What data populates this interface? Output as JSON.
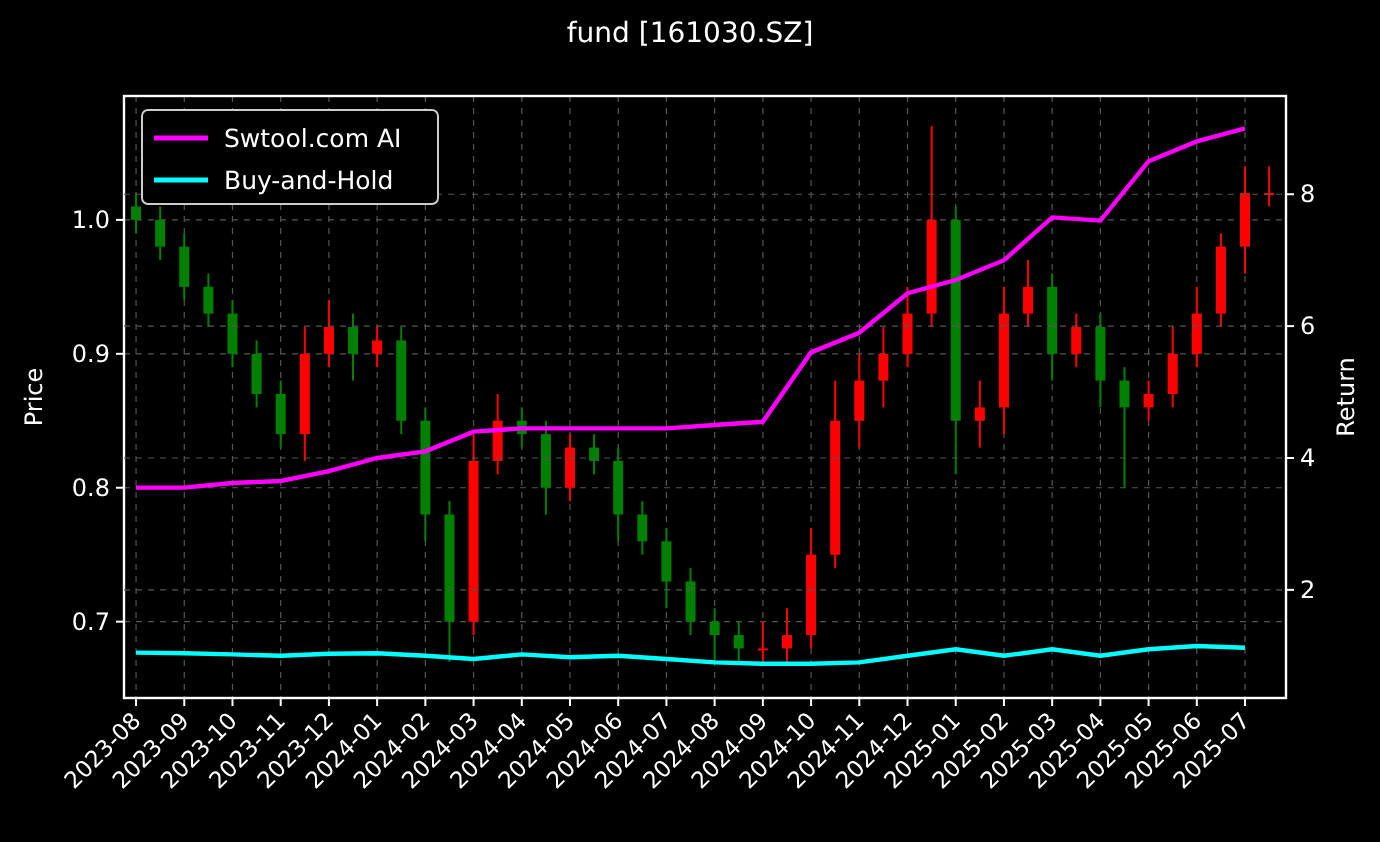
{
  "price_chart": {
    "chart_data": {
      "type": "candlestick",
      "title": "fund [161030.SZ]",
      "ylabel": "Price",
      "ylim": [
        0.643,
        1.0925
      ],
      "grid": true,
      "categories": [
        "2023-08",
        null,
        "2023-09",
        null,
        "2023-10",
        null,
        "2023-11",
        null,
        "2023-12",
        null,
        "2024-01",
        null,
        "2024-02",
        null,
        "2024-03",
        null,
        "2024-04",
        null,
        "2024-05",
        null,
        "2024-06",
        null,
        "2024-07",
        null,
        "2024-08",
        null,
        "2024-09",
        null,
        "2024-10",
        null,
        "2024-11",
        null,
        "2024-12",
        null,
        "2025-01",
        null,
        "2025-02",
        null,
        "2025-03",
        null,
        "2025-04",
        null,
        "2025-05",
        null,
        "2025-06",
        null,
        "2025-07",
        null
      ],
      "yticks": [
        {
          "value": 0.7,
          "label": "0.7"
        },
        {
          "value": 0.8,
          "label": "0.8"
        },
        {
          "value": 0.9,
          "label": "0.9"
        },
        {
          "value": 1.0,
          "label": "1.0"
        }
      ],
      "ohlc": [
        [
          1.01,
          1.02,
          0.99,
          1.0
        ],
        [
          1.0,
          1.01,
          0.97,
          0.98
        ],
        [
          0.98,
          0.99,
          0.94,
          0.95
        ],
        [
          0.95,
          0.96,
          0.92,
          0.93
        ],
        [
          0.93,
          0.94,
          0.89,
          0.9
        ],
        [
          0.9,
          0.91,
          0.86,
          0.87
        ],
        [
          0.87,
          0.88,
          0.83,
          0.84
        ],
        [
          0.84,
          0.92,
          0.82,
          0.9
        ],
        [
          0.9,
          0.94,
          0.89,
          0.92
        ],
        [
          0.92,
          0.93,
          0.88,
          0.9
        ],
        [
          0.9,
          0.92,
          0.89,
          0.91
        ],
        [
          0.91,
          0.92,
          0.84,
          0.85
        ],
        [
          0.85,
          0.86,
          0.76,
          0.78
        ],
        [
          0.78,
          0.79,
          0.67,
          0.7
        ],
        [
          0.7,
          0.84,
          0.69,
          0.82
        ],
        [
          0.82,
          0.87,
          0.81,
          0.85
        ],
        [
          0.85,
          0.86,
          0.83,
          0.84
        ],
        [
          0.84,
          0.85,
          0.78,
          0.8
        ],
        [
          0.8,
          0.84,
          0.79,
          0.83
        ],
        [
          0.83,
          0.84,
          0.81,
          0.82
        ],
        [
          0.82,
          0.83,
          0.76,
          0.78
        ],
        [
          0.78,
          0.79,
          0.75,
          0.76
        ],
        [
          0.76,
          0.77,
          0.71,
          0.73
        ],
        [
          0.73,
          0.74,
          0.69,
          0.7
        ],
        [
          0.7,
          0.71,
          0.67,
          0.69
        ],
        [
          0.69,
          0.7,
          0.67,
          0.68
        ],
        [
          0.68,
          0.7,
          0.67,
          0.68
        ],
        [
          0.68,
          0.71,
          0.67,
          0.69
        ],
        [
          0.69,
          0.77,
          0.68,
          0.75
        ],
        [
          0.75,
          0.88,
          0.74,
          0.85
        ],
        [
          0.85,
          0.9,
          0.83,
          0.88
        ],
        [
          0.88,
          0.92,
          0.86,
          0.9
        ],
        [
          0.9,
          0.95,
          0.89,
          0.93
        ],
        [
          0.93,
          1.07,
          0.92,
          1.0
        ],
        [
          1.0,
          1.01,
          0.81,
          0.85
        ],
        [
          0.85,
          0.88,
          0.83,
          0.86
        ],
        [
          0.86,
          0.95,
          0.84,
          0.93
        ],
        [
          0.93,
          0.97,
          0.92,
          0.95
        ],
        [
          0.95,
          0.96,
          0.88,
          0.9
        ],
        [
          0.9,
          0.93,
          0.89,
          0.92
        ],
        [
          0.92,
          0.93,
          0.86,
          0.88
        ],
        [
          0.88,
          0.89,
          0.8,
          0.86
        ],
        [
          0.86,
          0.88,
          0.85,
          0.87
        ],
        [
          0.87,
          0.92,
          0.86,
          0.9
        ],
        [
          0.9,
          0.95,
          0.89,
          0.93
        ],
        [
          0.93,
          0.99,
          0.92,
          0.98
        ],
        [
          0.98,
          1.04,
          0.96,
          1.02
        ],
        [
          1.02,
          1.04,
          1.01,
          1.02
        ]
      ]
    }
  },
  "return_chart": {
    "chart_data": {
      "type": "line",
      "ylabel": "Return",
      "grid": true,
      "legend": "upper left",
      "ylim": [
        0.36,
        9.49
      ],
      "yticks": [
        2,
        4,
        6,
        8
      ],
      "categories": [
        null,
        null,
        null,
        null,
        null,
        null,
        null,
        null,
        null,
        null,
        null,
        null,
        null,
        null,
        null,
        null,
        null,
        null,
        null,
        null,
        null,
        null,
        null,
        null
      ],
      "series": [
        {
          "name": "Swtool.com AI",
          "color": "#ff00ff",
          "values": [
            3.55,
            3.55,
            3.62,
            3.65,
            3.8,
            4.0,
            4.1,
            4.4,
            4.45,
            4.45,
            4.45,
            4.45,
            4.5,
            4.55,
            5.6,
            5.9,
            6.5,
            6.7,
            7.0,
            7.65,
            7.6,
            8.5,
            8.8,
            9.0
          ]
        },
        {
          "name": "Buy-and-Hold",
          "color": "#00ffff",
          "values": [
            1.05,
            1.04,
            1.02,
            1.0,
            1.03,
            1.04,
            1.0,
            0.95,
            1.02,
            0.98,
            1.0,
            0.95,
            0.9,
            0.88,
            0.88,
            0.9,
            1.0,
            1.1,
            1.0,
            1.1,
            1.0,
            1.1,
            1.15,
            1.12
          ]
        }
      ]
    }
  }
}
